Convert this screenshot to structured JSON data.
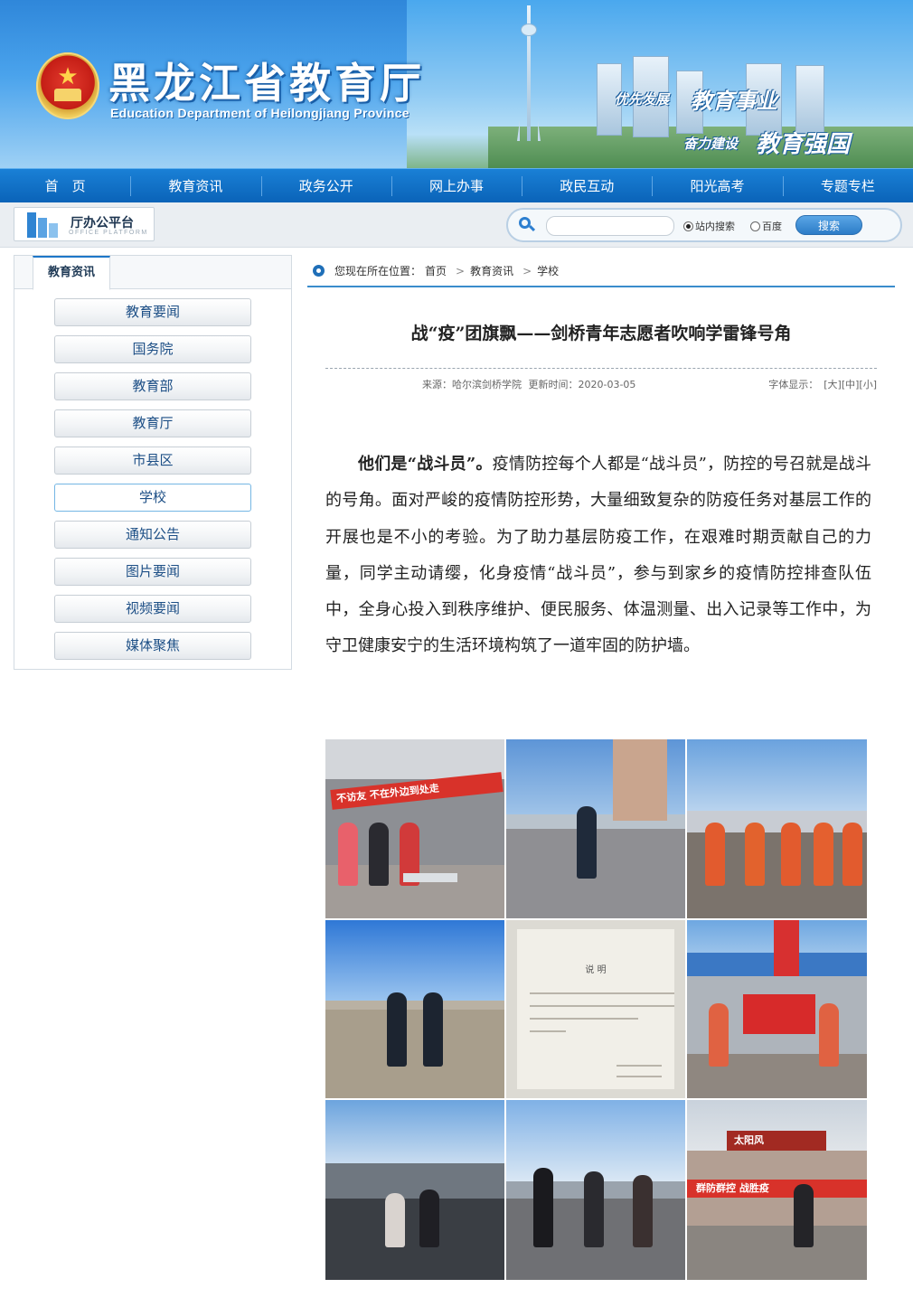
{
  "header": {
    "site_title": "黑龙江省教育厅",
    "site_subtitle": "Education Department of Heilongjiang Province",
    "slogans": [
      "优先发展",
      "教育事业",
      "奋力建设",
      "教育强国"
    ]
  },
  "nav": {
    "items": [
      "首　页",
      "教育资讯",
      "政务公开",
      "网上办事",
      "政民互动",
      "阳光高考",
      "专题专栏"
    ]
  },
  "toolbar": {
    "platform_title": "厅办公平台",
    "platform_sub": "OFFICE PLATFORM",
    "search_placeholder": "",
    "radio_site": "站内搜索",
    "radio_baidu": "百度",
    "search_button": "搜索"
  },
  "sidebar": {
    "tab": "教育资讯",
    "items": [
      "教育要闻",
      "国务院",
      "教育部",
      "教育厅",
      "市县区",
      "学校",
      "通知公告",
      "图片要闻",
      "视频要闻",
      "媒体聚焦"
    ],
    "active": "学校"
  },
  "breadcrumb": {
    "prefix": "您现在所在位置：",
    "items": [
      "首页",
      "教育资讯",
      "学校"
    ]
  },
  "article": {
    "title": "战“疫”团旗飘——剑桥青年志愿者吹响学雷锋号角",
    "source_label": "来源：",
    "source": "哈尔滨剑桥学院",
    "time_label": "更新时间：",
    "time": "2020-03-05",
    "font_label": "字体显示：",
    "font_large": "[大]",
    "font_medium": "[中]",
    "font_small": "[小]",
    "lead_bold": "他们是“战斗员”。",
    "paragraph": "疫情防控每个人都是“战斗员”，防控的号召就是战斗的号角。面对严峻的疫情防控形势，大量细致复杂的防疫任务对基层工作的开展也是不小的考验。为了助力基层防疫工作，在艰难时期贡献自己的力量，同学主动请缨，化身疫情“战斗员”，参与到家乡的疫情防控排查队伍中，全身心投入到秩序维护、便民服务、体温测量、出入记录等工作中，为守卫健康安宁的生活环境构筑了一道牢固的防护墙。"
  },
  "photos": {
    "banner1": "不访友 不在外边到处走",
    "doc_title": "说 明",
    "banner2": "群防群控 战胜疫",
    "banner3": "太阳风"
  },
  "colors": {
    "nav_blue": "#0a63b8",
    "accent": "#1d77c8"
  }
}
